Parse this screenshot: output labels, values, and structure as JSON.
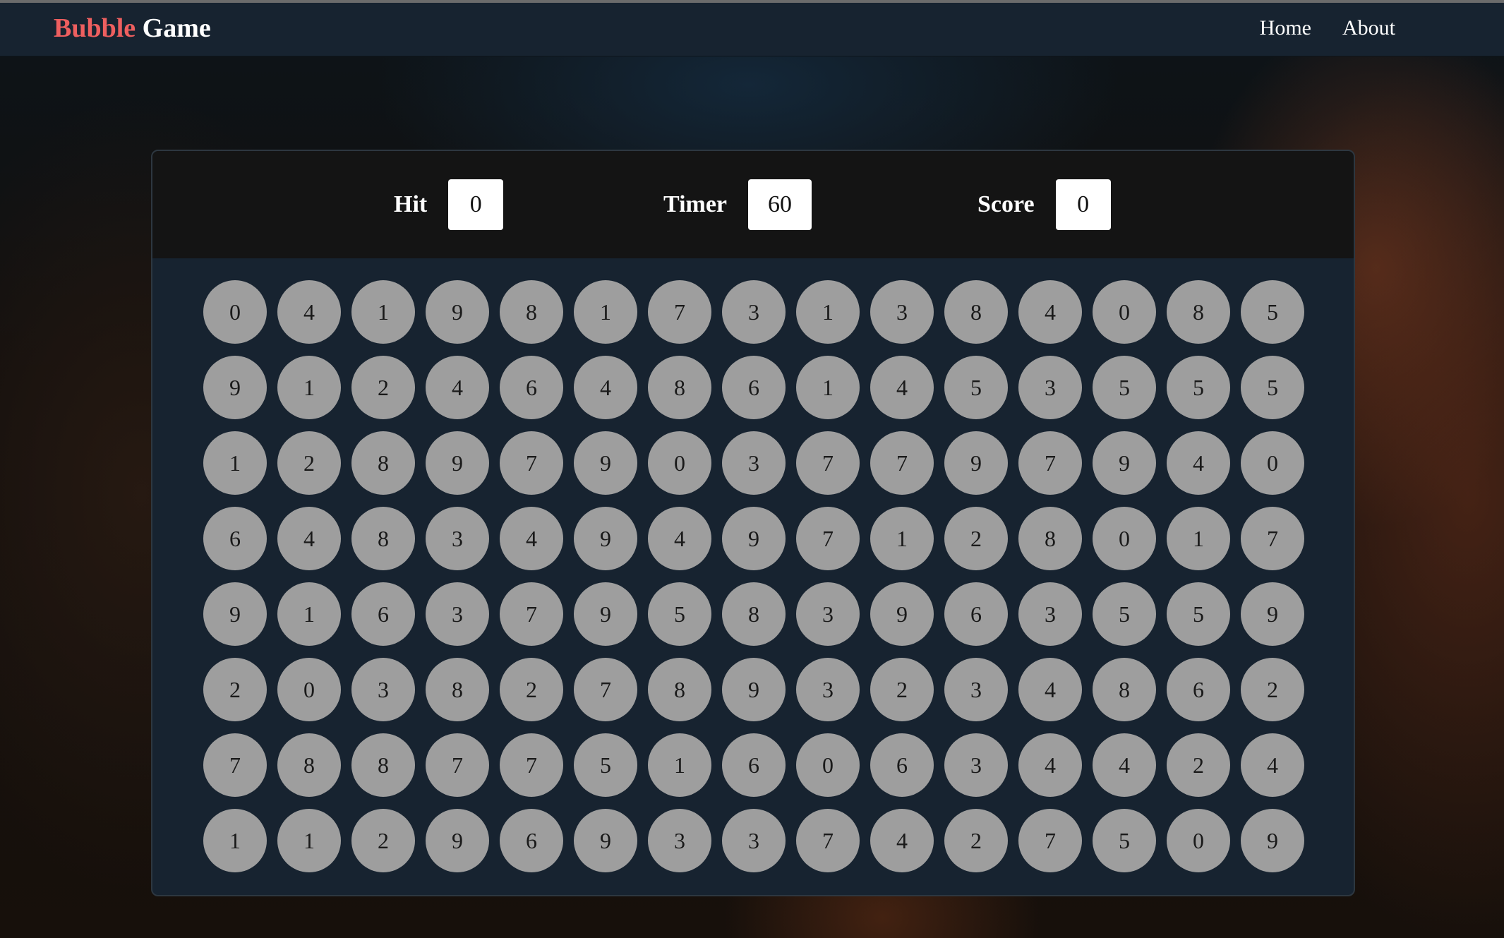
{
  "navbar": {
    "brand_accent": "Bubble",
    "brand_main": "Game",
    "links": [
      "Home",
      "About"
    ]
  },
  "stats": {
    "hit_label": "Hit",
    "hit_value": "0",
    "timer_label": "Timer",
    "timer_value": "60",
    "score_label": "Score",
    "score_value": "0"
  },
  "bubbles": [
    [
      0,
      4,
      1,
      9,
      8,
      1,
      7,
      3,
      1,
      3,
      8,
      4,
      0,
      8,
      5
    ],
    [
      9,
      1,
      2,
      4,
      6,
      4,
      8,
      6,
      1,
      4,
      5,
      3,
      5,
      5,
      5
    ],
    [
      1,
      2,
      8,
      9,
      7,
      9,
      0,
      3,
      7,
      7,
      9,
      7,
      9,
      4,
      0
    ],
    [
      6,
      4,
      8,
      3,
      4,
      9,
      4,
      9,
      7,
      1,
      2,
      8,
      0,
      1,
      7
    ],
    [
      9,
      1,
      6,
      3,
      7,
      9,
      5,
      8,
      3,
      9,
      6,
      3,
      5,
      5,
      9
    ],
    [
      2,
      0,
      3,
      8,
      2,
      7,
      8,
      9,
      3,
      2,
      3,
      4,
      8,
      6,
      2
    ],
    [
      7,
      8,
      8,
      7,
      7,
      5,
      1,
      6,
      0,
      6,
      3,
      4,
      4,
      2,
      4
    ],
    [
      1,
      1,
      2,
      9,
      6,
      9,
      3,
      3,
      7,
      4,
      2,
      7,
      5,
      0,
      9
    ]
  ],
  "colors": {
    "navbar_bg": "#172330",
    "brand_accent": "#ee5f5f",
    "panel_top_bg": "#141414",
    "panel_bg": "#172330",
    "bubble_bg": "#9e9e9e"
  }
}
